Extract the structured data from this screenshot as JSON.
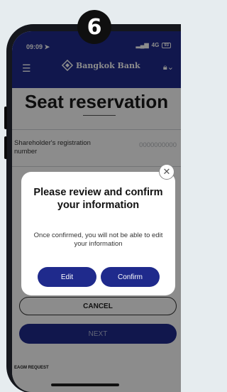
{
  "step_number": "6",
  "status_bar": {
    "time": "09:09",
    "network": "4G",
    "battery": "93"
  },
  "header": {
    "bank_name": "Bangkok Bank",
    "menu_icon": "hamburger-icon",
    "logo_icon": "diamond-logo-icon",
    "lock_icon": "lock-icon"
  },
  "page": {
    "title": "Seat reservation",
    "field_label": "Shareholder's registration number",
    "field_value": "0000000000",
    "cancel_label": "CANCEL",
    "next_label": "NEXT",
    "footer_label": "EAGM REQUEST"
  },
  "modal": {
    "title": "Please review and confirm your information",
    "message": "Once confirmed, you will not be able to edit your information",
    "edit_label": "Edit",
    "confirm_label": "Confirm"
  },
  "colors": {
    "brand_blue": "#1f2a8c",
    "overlay": "rgba(0,0,0,0.45)"
  }
}
